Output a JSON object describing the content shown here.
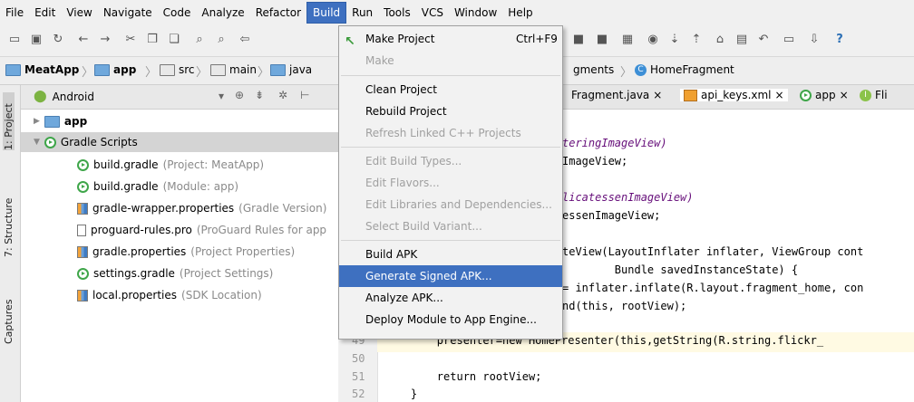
{
  "menubar": [
    "File",
    "Edit",
    "View",
    "Navigate",
    "Code",
    "Analyze",
    "Refactor",
    "Build",
    "Run",
    "Tools",
    "VCS",
    "Window",
    "Help"
  ],
  "breadcrumb": {
    "items": [
      "MeatApp",
      "app",
      "src",
      "main",
      "java"
    ],
    "right_items": [
      "gments",
      "HomeFragment"
    ]
  },
  "project_panel": {
    "view_selector": "Android",
    "tree": [
      {
        "name": "app",
        "detail": "",
        "kind": "folder"
      },
      {
        "name": "Gradle Scripts",
        "detail": "",
        "kind": "gradle"
      },
      {
        "name": "build.gradle",
        "detail": "(Project: MeatApp)",
        "kind": "gradle"
      },
      {
        "name": "build.gradle",
        "detail": "(Module: app)",
        "kind": "gradle"
      },
      {
        "name": "gradle-wrapper.properties",
        "detail": "(Gradle Version)",
        "kind": "props"
      },
      {
        "name": "proguard-rules.pro",
        "detail": "(ProGuard Rules for app",
        "kind": "file"
      },
      {
        "name": "gradle.properties",
        "detail": "(Project Properties)",
        "kind": "props"
      },
      {
        "name": "settings.gradle",
        "detail": "(Project Settings)",
        "kind": "gradle"
      },
      {
        "name": "local.properties",
        "detail": "(SDK Location)",
        "kind": "props"
      }
    ]
  },
  "side_tabs": [
    "1: Project",
    "7: Structure",
    "Captures"
  ],
  "editor_tabs": [
    {
      "label": "Fragment.java",
      "close": "×"
    },
    {
      "label": "api_keys.xml",
      "close": "×"
    },
    {
      "label": "app",
      "close": "×"
    },
    {
      "label": "Fli",
      "close": ""
    }
  ],
  "code_lines": [
    {
      "ln": "",
      "text": "teringImageView)"
    },
    {
      "ln": "",
      "text": "ImageView;"
    },
    {
      "ln": "",
      "text": ""
    },
    {
      "ln": "",
      "text": "licatessenImageView)"
    },
    {
      "ln": "",
      "text": "essenImageView;"
    },
    {
      "ln": "",
      "text": ""
    },
    {
      "ln": "",
      "text": "teView(LayoutInflater inflater, ViewGroup cont"
    },
    {
      "ln": "",
      "text": "        Bundle savedInstanceState) {"
    },
    {
      "ln": "",
      "text": "= inflater.inflate(R.layout.fragment_home, con"
    },
    {
      "ln": "",
      "text": "nd(this, rootView);"
    },
    {
      "ln": "49",
      "text": "        presenter=new HomePresenter(this,getString(R.string.flickr_"
    },
    {
      "ln": "50",
      "text": ""
    },
    {
      "ln": "51",
      "text": "        return rootView;"
    },
    {
      "ln": "52",
      "text": "    }"
    }
  ],
  "build_menu": {
    "items": [
      {
        "label": "Make Project",
        "shortcut": "Ctrl+F9",
        "state": "normal",
        "icon": "hammer-icon"
      },
      {
        "label": "Make",
        "shortcut": "",
        "state": "disabled"
      },
      {
        "label": "Clean Project",
        "shortcut": "",
        "state": "normal"
      },
      {
        "label": "Rebuild Project",
        "shortcut": "",
        "state": "normal"
      },
      {
        "label": "Refresh Linked C++ Projects",
        "shortcut": "",
        "state": "disabled"
      },
      {
        "label": "Edit Build Types...",
        "shortcut": "",
        "state": "disabled"
      },
      {
        "label": "Edit Flavors...",
        "shortcut": "",
        "state": "disabled"
      },
      {
        "label": "Edit Libraries and Dependencies...",
        "shortcut": "",
        "state": "disabled"
      },
      {
        "label": "Select Build Variant...",
        "shortcut": "",
        "state": "disabled"
      },
      {
        "label": "Build APK",
        "shortcut": "",
        "state": "normal"
      },
      {
        "label": "Generate Signed APK...",
        "shortcut": "",
        "state": "highlighted"
      },
      {
        "label": "Analyze APK...",
        "shortcut": "",
        "state": "normal"
      },
      {
        "label": "Deploy Module to App Engine...",
        "shortcut": "",
        "state": "normal"
      }
    ]
  },
  "colors": {
    "accent": "#3e70c0",
    "gradle_green": "#3fa64a",
    "line_highlight": "#fffae3"
  }
}
